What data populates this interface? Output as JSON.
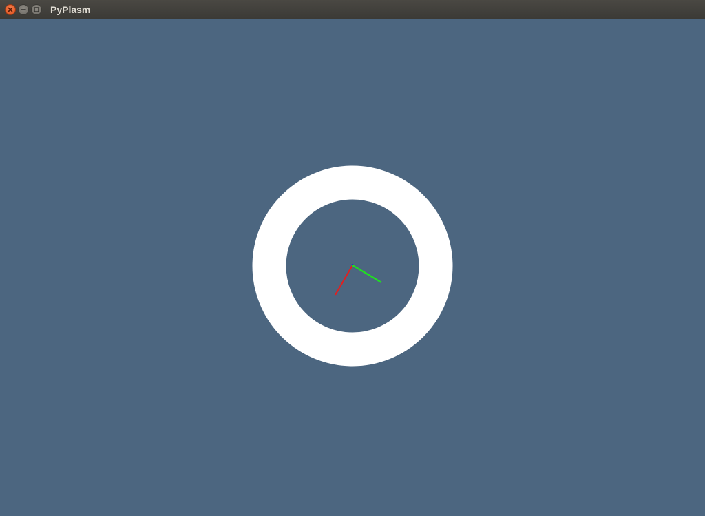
{
  "window": {
    "title": "PyPlasm",
    "background_color": "#4c6680"
  },
  "titlebar_buttons": [
    {
      "name": "close-icon",
      "color": "#e9541f"
    },
    {
      "name": "minimize-icon",
      "color": "#7d7a74"
    },
    {
      "name": "maximize-icon",
      "color": "#7d7a74"
    }
  ],
  "scene": {
    "object": "torus",
    "object_color": "#ffffff",
    "axes": {
      "x_axis_color": "#e02020",
      "y_axis_color": "#20e020",
      "z_axis_color": "#2020e0"
    }
  }
}
